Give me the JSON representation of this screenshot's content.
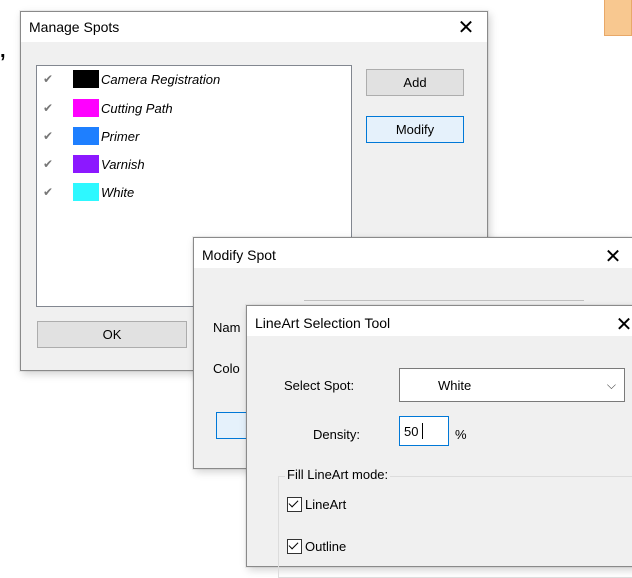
{
  "manage_spots": {
    "title": "Manage Spots",
    "spots": [
      {
        "name": "Camera Registration",
        "color": "#000000"
      },
      {
        "name": "Cutting Path",
        "color": "#ff00ff"
      },
      {
        "name": "Primer",
        "color": "#1e7fff"
      },
      {
        "name": "Varnish",
        "color": "#8c18ff"
      },
      {
        "name": "White",
        "color": "#2ef8ff"
      }
    ],
    "add_label": "Add",
    "modify_label": "Modify",
    "ok_label": "OK"
  },
  "modify_spot": {
    "title": "Modify Spot",
    "name_label": "Nam",
    "color_label": "Colo"
  },
  "lineart_tool": {
    "title": "LineArt Selection Tool",
    "select_spot_label": "Select Spot:",
    "select_spot_value": "White",
    "density_label": "Density:",
    "density_value": "50",
    "density_unit": "%",
    "fill_group_label": "Fill LineArt mode:",
    "option_lineart": "LineArt",
    "option_outline": "Outline"
  },
  "icons": {
    "close": "close-icon",
    "check": "check-icon",
    "dropdown": "chevron-down-icon"
  },
  "accent_color": "#0078d7",
  "background_window_color": "#f5c48a"
}
